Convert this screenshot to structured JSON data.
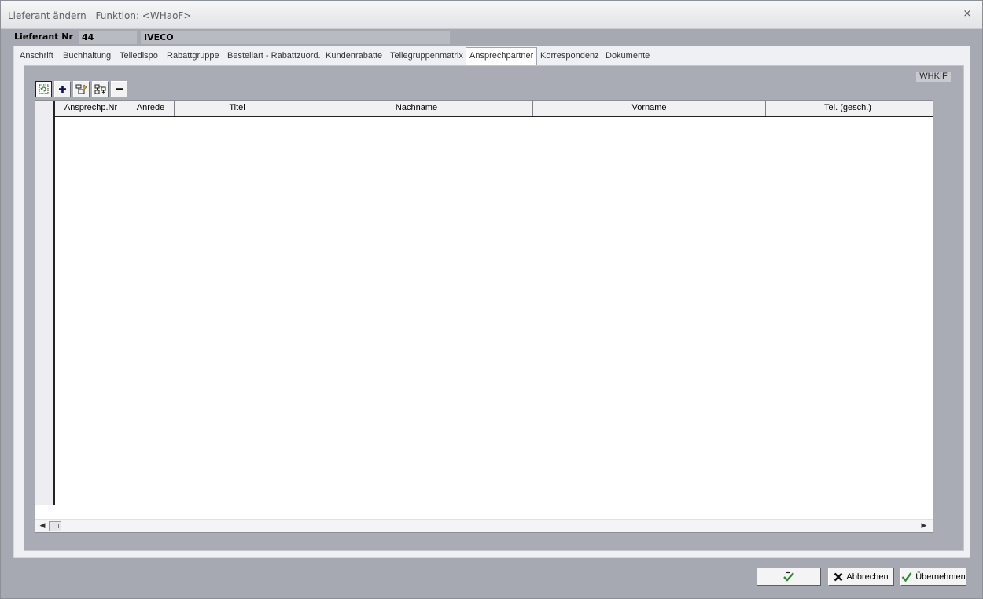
{
  "window": {
    "title": "Lieferant ändern",
    "function_label": "Funktion: <WHaoF>",
    "close_glyph": "×"
  },
  "supplier": {
    "label": "Lieferant Nr",
    "number": "44",
    "name": "IVECO"
  },
  "tabs": [
    {
      "label": "Anschrift"
    },
    {
      "label": "Buchhaltung"
    },
    {
      "label": "Teiledispo"
    },
    {
      "label": "Rabattgruppe"
    },
    {
      "label": "Bestellart - Rabattzuord."
    },
    {
      "label": "Kundenrabatte"
    },
    {
      "label": "Teilegruppenmatrix"
    },
    {
      "label": "Ansprechpartner",
      "active": true
    },
    {
      "label": "Korrespondenz"
    },
    {
      "label": "Dokumente"
    }
  ],
  "panel": {
    "code_badge": "WHKIF",
    "toolbar": [
      {
        "name": "refresh-button",
        "icon": "refresh-icon"
      },
      {
        "name": "add-button",
        "icon": "plus-icon"
      },
      {
        "name": "edit-button",
        "icon": "edit-record-icon"
      },
      {
        "name": "copy-button",
        "icon": "copy-record-icon"
      },
      {
        "name": "delete-button",
        "icon": "minus-icon"
      }
    ]
  },
  "grid": {
    "columns": [
      "Ansprechp.Nr",
      "Anrede",
      "Titel",
      "Nachname",
      "Vorname",
      "Tel. (gesch.)"
    ],
    "rows": []
  },
  "footer": {
    "ok_label": "",
    "cancel_label": "Abbrechen",
    "apply_label": "Übernehmen"
  },
  "colors": {
    "window_bg": "#a6a9b1",
    "panel_bg": "#eef0f4",
    "ok_check": "#2d8a2d",
    "accent_plus": "#101060"
  }
}
